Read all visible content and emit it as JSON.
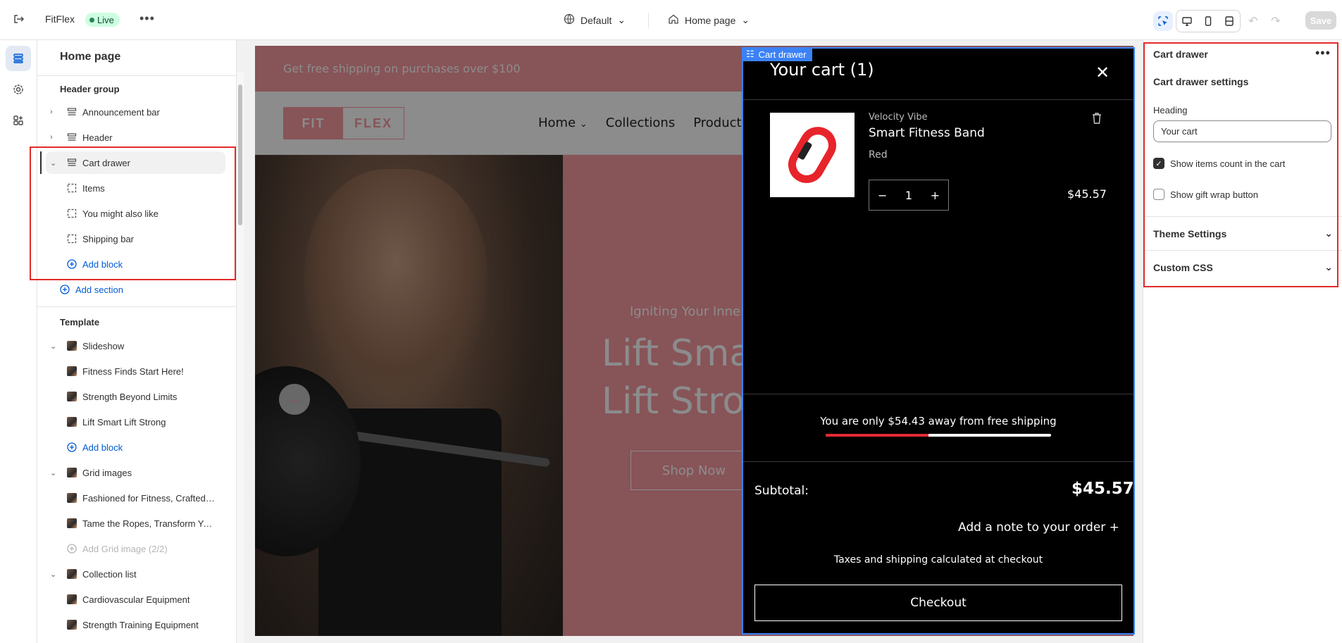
{
  "topbar": {
    "store_name": "FitFlex",
    "status_badge": "Live",
    "theme_select": "Default",
    "page_select": "Home page",
    "save_label": "Save"
  },
  "sidebar": {
    "title": "Home page",
    "header_group_label": "Header group",
    "header_items": [
      {
        "label": "Announcement bar"
      },
      {
        "label": "Header"
      },
      {
        "label": "Cart drawer"
      }
    ],
    "cart_children": [
      {
        "label": "Items"
      },
      {
        "label": "You might also like"
      },
      {
        "label": "Shipping bar"
      },
      {
        "label": "Add block"
      }
    ],
    "add_section_label": "Add section",
    "template_label": "Template",
    "slideshow": {
      "label": "Slideshow",
      "children": [
        "Fitness Finds Start Here!",
        "Strength Beyond Limits",
        "Lift Smart Lift Strong"
      ],
      "add_label": "Add block"
    },
    "grid_images": {
      "label": "Grid images",
      "children": [
        "Fashioned for Fitness, Crafted for You",
        "Tame the Ropes, Transform Your Body"
      ],
      "add_label": "Add Grid image (2/2)"
    },
    "collection_list": {
      "label": "Collection list",
      "children": [
        "Cardiovascular Equipment",
        "Strength Training Equipment"
      ]
    }
  },
  "preview": {
    "promo_text": "Get free shipping on purchases over $100",
    "logo_left": "FIT",
    "logo_right": "FLEX",
    "nav": [
      "Home",
      "Collections",
      "Products"
    ],
    "hero_subtitle": "Igniting Your Inner",
    "hero_title": "Lift Sma\nLift Stro",
    "hero_button": "Shop Now"
  },
  "cart_drawer": {
    "tag": "Cart drawer",
    "heading": "Your cart (1)",
    "item": {
      "vendor": "Velocity Vibe",
      "name": "Smart Fitness Band",
      "variant": "Red",
      "quantity": "1",
      "price": "$45.57"
    },
    "shipping_message": "You are only $54.43 away from free shipping",
    "shipping_progress": 0.456,
    "subtotal_label": "Subtotal:",
    "subtotal_value": "$45.57",
    "note_label": "Add a note to your order +",
    "tax_note": "Taxes and shipping calculated at checkout",
    "checkout_label": "Checkout"
  },
  "settings": {
    "title": "Cart drawer",
    "section_title": "Cart drawer settings",
    "heading_label": "Heading",
    "heading_value": "Your cart",
    "show_count_label": "Show items count in the cart",
    "show_count_checked": true,
    "gift_wrap_label": "Show gift wrap button",
    "gift_wrap_checked": false,
    "theme_settings_label": "Theme Settings",
    "custom_css_label": "Custom CSS"
  },
  "colors": {
    "accent": "#005bd3",
    "brand_pink": "#f69aa0",
    "highlight_red": "#e22a2a",
    "selection_blue": "#3b82f6"
  }
}
